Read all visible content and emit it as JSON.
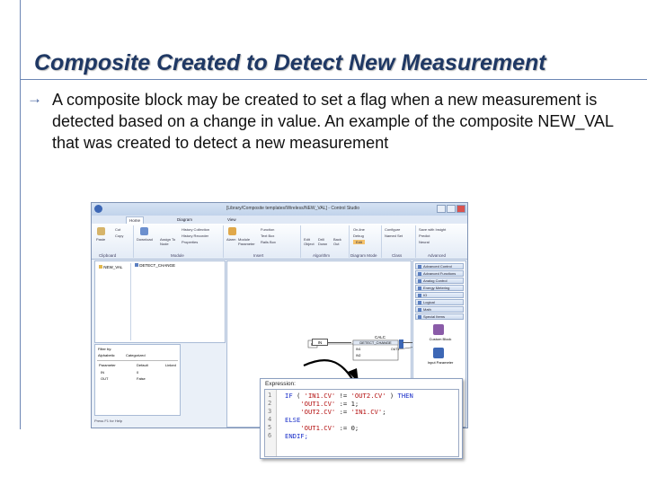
{
  "slide": {
    "title": "Composite Created to Detect New Measurement",
    "body": "A composite block may be created to set a flag when a new measurement is detected based on a change in value. An example of the composite NEW_VAL that was created to detect a new measurement"
  },
  "window": {
    "title": "[Library/Composite templates/Wireless/NEW_VAL] - Control Studio",
    "tabs": [
      "Home",
      "Diagram",
      "View"
    ]
  },
  "ribbon": {
    "buttons": {
      "paste": "Paste",
      "cut": "Cut",
      "copy": "Copy",
      "download": "Download",
      "assign": "Assign To Node",
      "history_collection": "History Collection",
      "history_recorder": "History Recorder",
      "properties": "Properties",
      "alarm": "Alarm",
      "module_parameter": "Module Parameter",
      "function": "Function",
      "text_box": "Text Box",
      "rails_box": "Rails Box",
      "edit_object": "Edit Object",
      "drill_down": "Drill Down",
      "back_out": "Back Out",
      "online": "On-line",
      "debug": "Debug",
      "edit": "Edit",
      "configure": "Configure",
      "named_set": "Named Set",
      "save_with_insight": "Save with Insight",
      "predict": "Predict",
      "neural": "Neural"
    },
    "groups": [
      "Clipboard",
      "Module",
      "Insert",
      "Algorithm",
      "Diagram Mode",
      "Class",
      "Advanced"
    ]
  },
  "tree": {
    "root": "NEW_VAL",
    "child": "DETECT_CHANGE"
  },
  "filter": {
    "label": "Filter by:",
    "tabs": [
      "Alphabetic",
      "Categorized"
    ],
    "columns": [
      "Parameter",
      "Default",
      "Linked"
    ],
    "rows": [
      [
        "IN",
        "0",
        ""
      ],
      [
        "OUT",
        "False",
        ""
      ]
    ]
  },
  "status_text": "Press F1 for Help",
  "diagram": {
    "block_type": "CALC",
    "block_name": "DETECT_CHANGE",
    "in_port": "IN",
    "out_port": "OUT",
    "in1": "IN1",
    "out1": "OUT1",
    "in2": "IN2",
    "in_label": "IN",
    "out_label": "OUT"
  },
  "palette": {
    "items": [
      "Advanced Control",
      "Advanced Functions",
      "Analog Control",
      "Energy Metering",
      "IO",
      "Logical",
      "Math",
      "Special Items"
    ],
    "tool1": "Custom Block",
    "tool2": "Input Parameter"
  },
  "expression": {
    "label": "Expression:",
    "lines": [
      {
        "n": "1",
        "kw1": "IF",
        "mid": " ( ",
        "s1": "'IN1.CV'",
        "op": " != ",
        "s2": "'OUT2.CV'",
        "end": " ) ",
        "kw2": "THEN"
      },
      {
        "n": "2",
        "kw1": "",
        "mid": "    ",
        "s1": "'OUT1.CV'",
        "op": " := 1;",
        "s2": "",
        "end": "",
        "kw2": ""
      },
      {
        "n": "3",
        "kw1": "",
        "mid": "    ",
        "s1": "'OUT2.CV'",
        "op": " := ",
        "s2": "'IN1.CV'",
        "end": ";",
        "kw2": ""
      },
      {
        "n": "4",
        "kw1": "ELSE",
        "mid": "",
        "s1": "",
        "op": "",
        "s2": "",
        "end": "",
        "kw2": ""
      },
      {
        "n": "5",
        "kw1": "",
        "mid": "    ",
        "s1": "'OUT1.CV'",
        "op": " := 0;",
        "s2": "",
        "end": "",
        "kw2": ""
      },
      {
        "n": "6",
        "kw1": "ENDIF;",
        "mid": "",
        "s1": "",
        "op": "",
        "s2": "",
        "end": "",
        "kw2": ""
      }
    ]
  },
  "colors": {
    "title": "#1f3864",
    "accent": "#4a67a0",
    "keyword": "#1a2fc9",
    "string": "#b41010"
  }
}
